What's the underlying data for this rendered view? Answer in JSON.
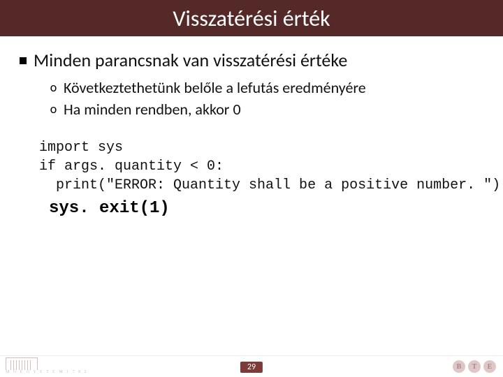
{
  "title": "Visszatérési érték",
  "bullets": {
    "main": "Minden parancsnak van visszatérési értéke",
    "subs": [
      "Következtethetünk belőle a lefutás eredményére",
      "Ha minden rendben, akkor 0"
    ]
  },
  "code": {
    "lines": [
      "import sys",
      "if args. quantity < 0:",
      "  print(\"ERROR: Quantity shall be a positive number. \")"
    ],
    "emphasis": "sys. exit(1)"
  },
  "footer": {
    "page": "29",
    "left_logo_text": "M Ű E G Y E T E M  1 7 8 2",
    "right_badges": [
      "B",
      "T",
      "E"
    ]
  }
}
